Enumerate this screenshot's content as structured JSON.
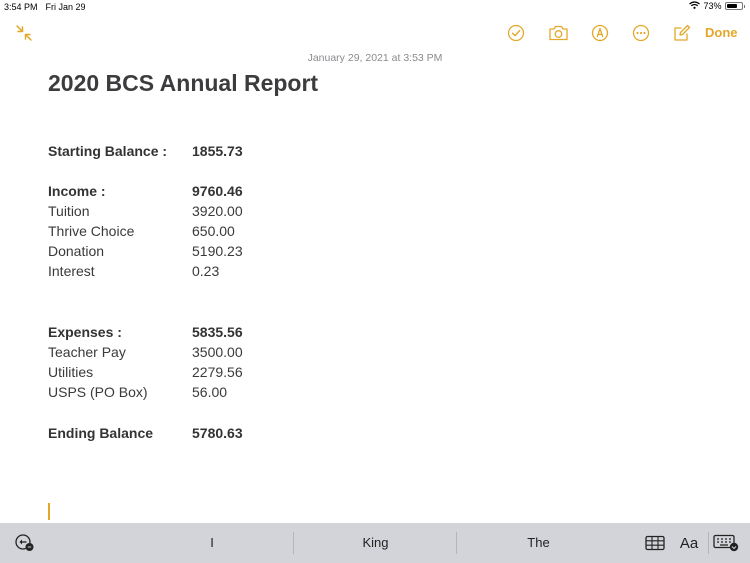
{
  "status_bar": {
    "time": "3:54 PM",
    "date": "Fri Jan 29",
    "battery": "73%",
    "battery_level": 0.73
  },
  "toolbar": {
    "icons": [
      "collapse-icon",
      "checklist-icon",
      "camera-icon",
      "markup-icon",
      "more-icon",
      "compose-icon"
    ],
    "done_label": "Done",
    "accent_color": "#e3a829"
  },
  "note": {
    "timestamp": "January 29, 2021 at 3:53 PM",
    "title": "2020 BCS Annual Report",
    "starting_balance": {
      "label": "Starting Balance :",
      "value": "1855.73"
    },
    "income": {
      "label": "Income :",
      "value": "9760.46",
      "items": [
        {
          "label": "Tuition",
          "value": "3920.00"
        },
        {
          "label": "Thrive Choice",
          "value": "650.00"
        },
        {
          "label": "Donation",
          "value": "5190.23"
        },
        {
          "label": "Interest",
          "value": "0.23"
        }
      ]
    },
    "expenses": {
      "label": "Expenses :",
      "value": "5835.56",
      "items": [
        {
          "label": "Teacher Pay",
          "value": "3500.00"
        },
        {
          "label": "Utilities",
          "value": "2279.56"
        },
        {
          "label": "USPS (PO Box)",
          "value": "56.00"
        }
      ]
    },
    "ending_balance": {
      "label": "Ending Balance",
      "value": "5780.63"
    }
  },
  "keyboard_bar": {
    "suggestions": [
      "I",
      "King",
      "The"
    ],
    "format_label": "Aa"
  }
}
